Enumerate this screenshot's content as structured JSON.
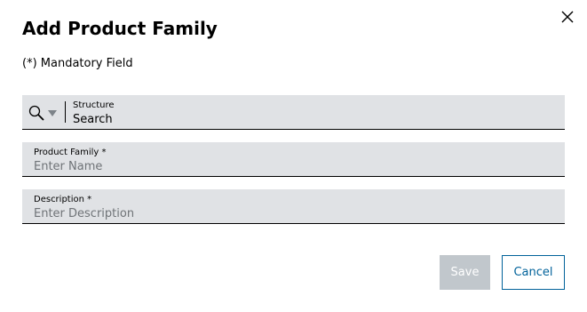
{
  "dialog": {
    "title": "Add Product Family",
    "mandatory_note": "(*) Mandatory Field",
    "close_icon": "close-icon"
  },
  "structure_field": {
    "label": "Structure",
    "placeholder": "Search",
    "search_icon": "search-icon",
    "dropdown_icon": "caret-down-icon"
  },
  "product_family_field": {
    "label": "Product Family *",
    "placeholder": "Enter Name"
  },
  "description_field": {
    "label": "Description *",
    "placeholder": "Enter Description"
  },
  "buttons": {
    "save_label": "Save",
    "cancel_label": "Cancel"
  },
  "colors": {
    "field_background": "#e0e2e5",
    "save_disabled": "#c1c7cc",
    "accent": "#00629a"
  }
}
